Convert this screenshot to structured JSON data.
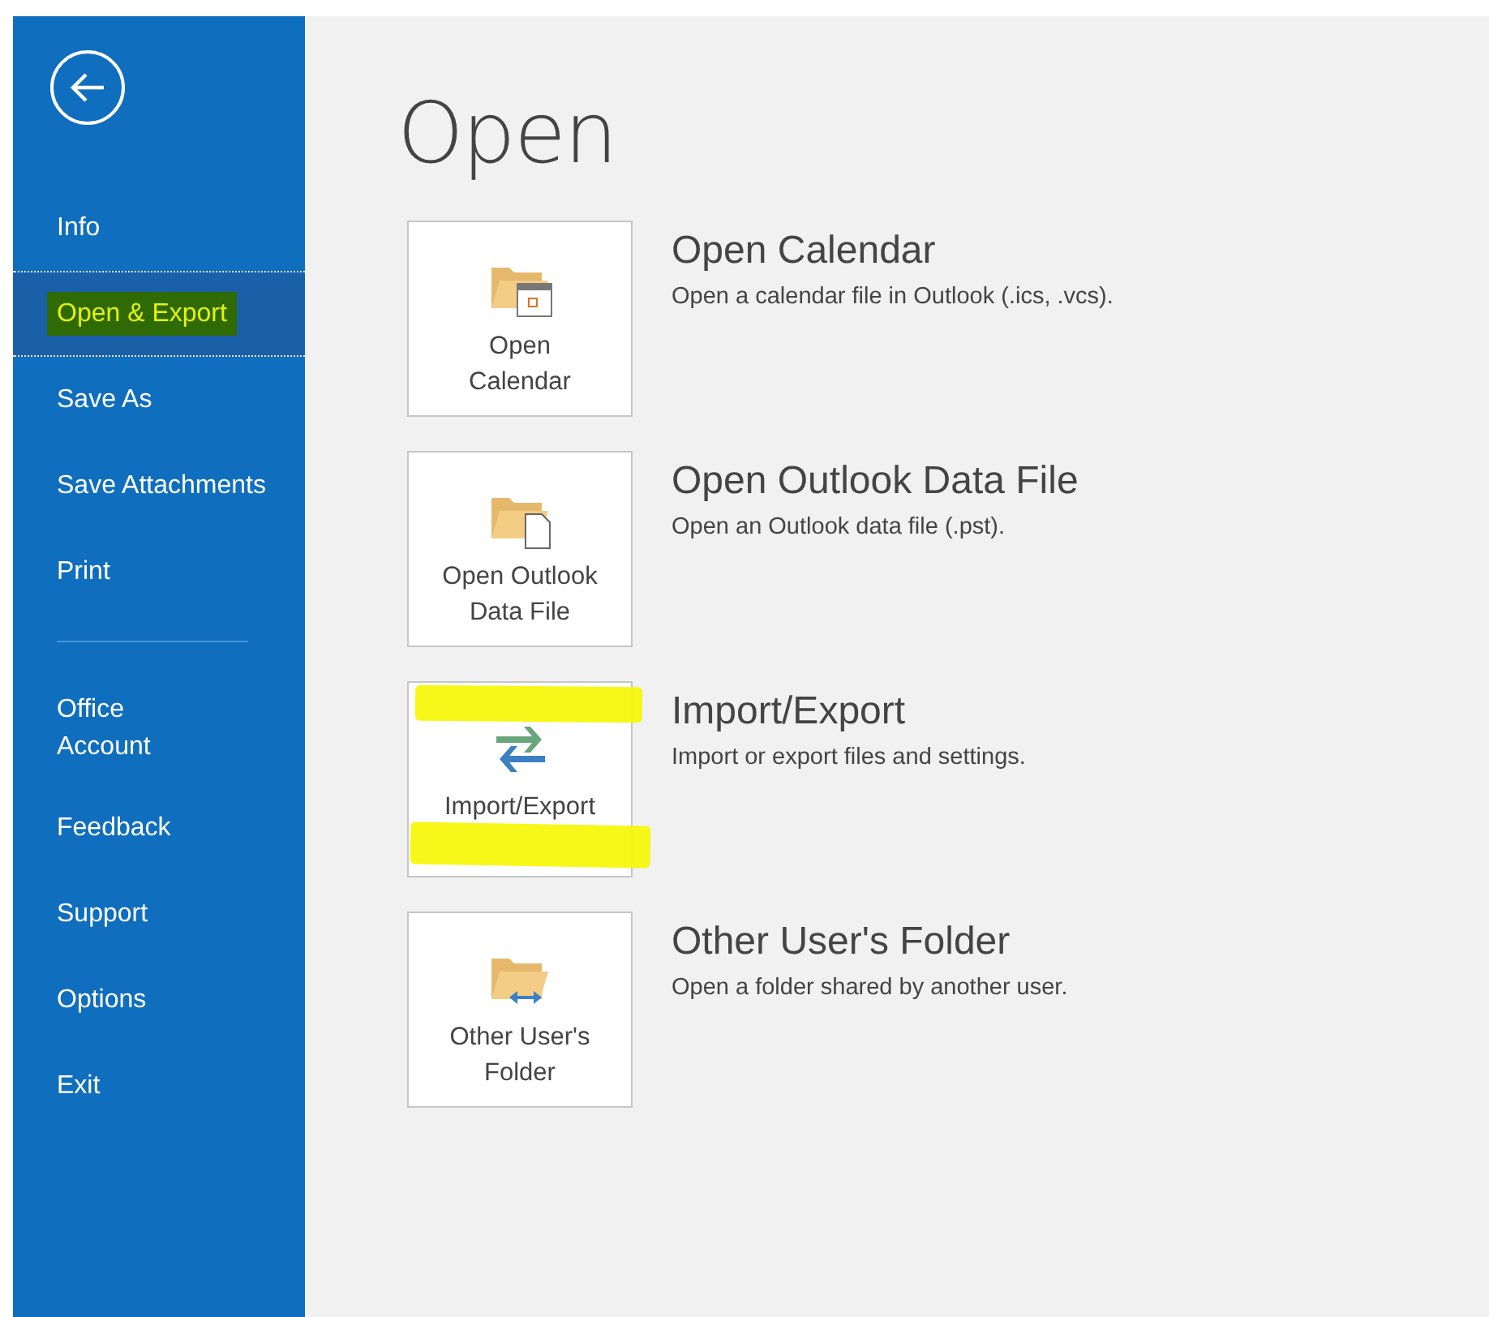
{
  "sidebar": {
    "items": [
      {
        "kind": "item",
        "label": "Info",
        "selected": false,
        "highlighted": false
      },
      {
        "kind": "item",
        "label": "Open & Export",
        "selected": true,
        "highlighted": true
      },
      {
        "kind": "item",
        "label": "Save As",
        "selected": false,
        "highlighted": false
      },
      {
        "kind": "item",
        "label": "Save Attachments",
        "selected": false,
        "highlighted": false
      },
      {
        "kind": "item",
        "label": "Print",
        "selected": false,
        "highlighted": false
      },
      {
        "kind": "divider"
      },
      {
        "kind": "wrapped",
        "label": "Office Account",
        "selected": false,
        "highlighted": false
      },
      {
        "kind": "item",
        "label": "Feedback",
        "selected": false,
        "highlighted": false
      },
      {
        "kind": "item",
        "label": "Support",
        "selected": false,
        "highlighted": false
      },
      {
        "kind": "item",
        "label": "Options",
        "selected": false,
        "highlighted": false
      },
      {
        "kind": "item",
        "label": "Exit",
        "selected": false,
        "highlighted": false
      }
    ]
  },
  "page_title": "Open",
  "tiles": [
    {
      "kind": "calendar",
      "label": "Open\nCalendar",
      "title": "Open Calendar",
      "description": "Open a calendar file in Outlook (.ics, .vcs).",
      "highlighted": false
    },
    {
      "kind": "data-file",
      "label": "Open Outlook\nData File",
      "title": "Open Outlook Data File",
      "description": "Open an Outlook data file (.pst).",
      "highlighted": false
    },
    {
      "kind": "import-export",
      "label": "Import/Export",
      "title": "Import/Export",
      "description": "Import or export files and settings.",
      "highlighted": true
    },
    {
      "kind": "shared-folder",
      "label": "Other User's\nFolder",
      "title": "Other User's Folder",
      "description": "Open a folder shared by another user.",
      "highlighted": false
    }
  ]
}
